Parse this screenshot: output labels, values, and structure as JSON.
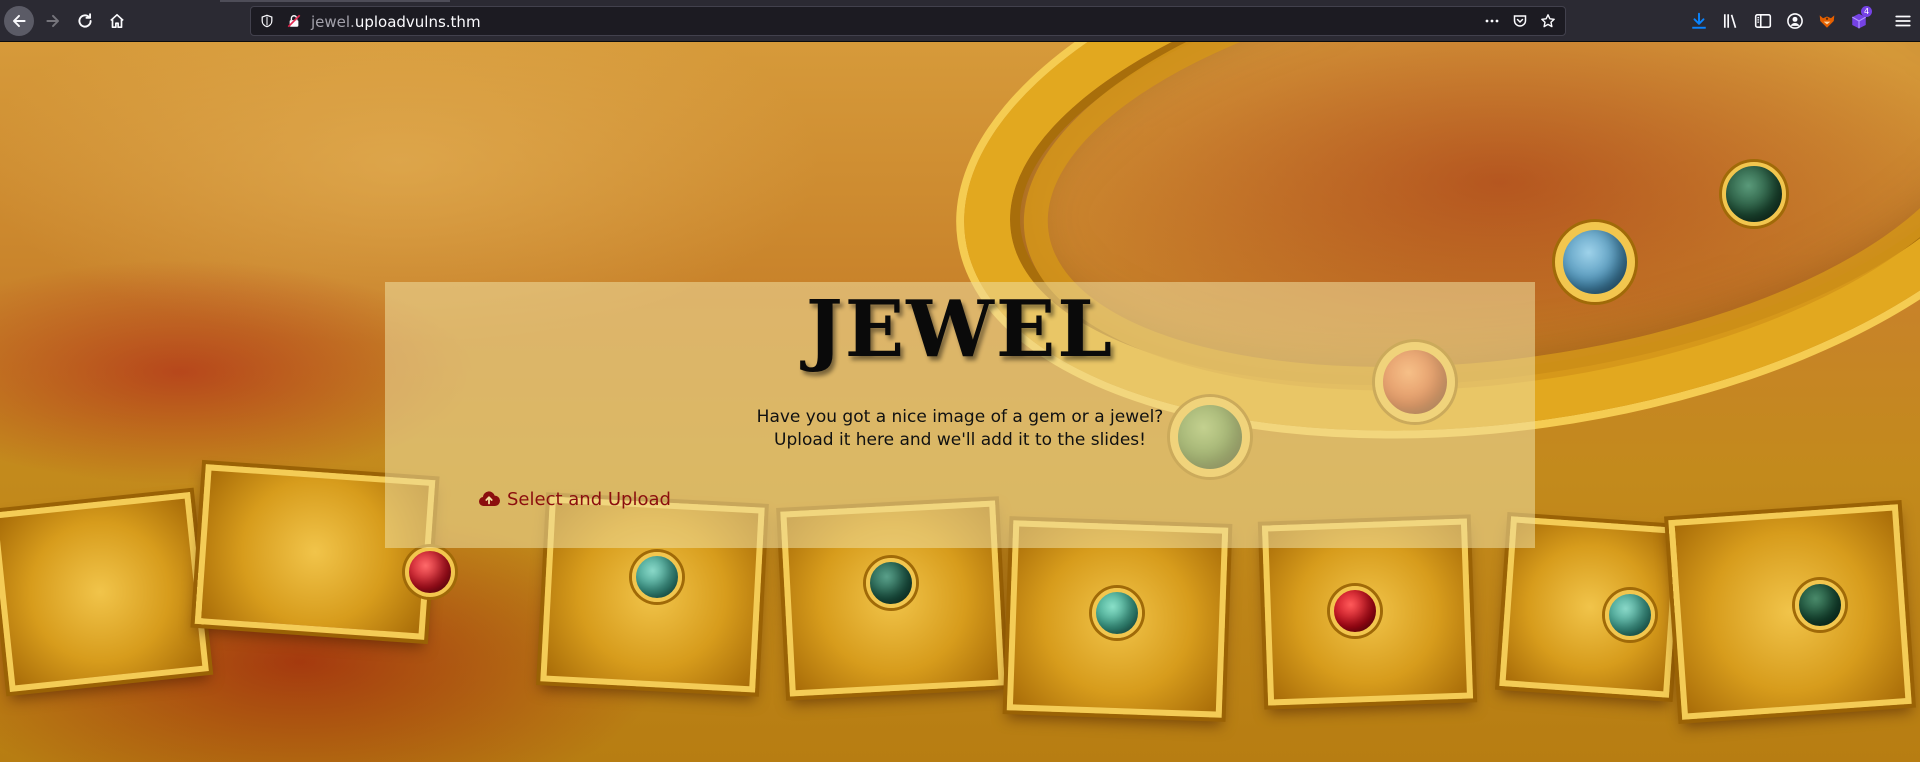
{
  "browser": {
    "url_subdomain": "jewel.",
    "url_domain": "uploadvulns.thm",
    "extensions_badge": "4",
    "icons": {
      "back": "back-arrow-icon",
      "forward": "forward-arrow-icon",
      "reload": "reload-icon",
      "home": "home-icon",
      "tracking": "tracking-shield-icon",
      "insecure": "insecure-lock-icon",
      "page_actions": "more-actions-icon",
      "pocket": "pocket-icon",
      "bookmark": "bookmark-star-icon",
      "downloads": "download-icon",
      "library": "library-icon",
      "sidebar": "sidebar-icon",
      "account": "account-icon",
      "extension_fox": "foxyproxy-icon",
      "extension_cube": "extension-cube-icon",
      "menu": "hamburger-menu-icon"
    }
  },
  "page": {
    "logo": "JEWEL",
    "intro_line1": "Have you got a nice image of a gem or a jewel?",
    "intro_line2": "Upload it here and we'll add it to the slides!",
    "upload_label": "Select and Upload",
    "upload_icon": "cloud-upload-icon"
  },
  "colors": {
    "chrome": "#2b2a33",
    "urlbar": "#1c1b22",
    "accent_download": "#0a84ff",
    "panel_overlay": "rgba(238,222,160,0.55)",
    "upload_text": "#8b0e0e"
  }
}
